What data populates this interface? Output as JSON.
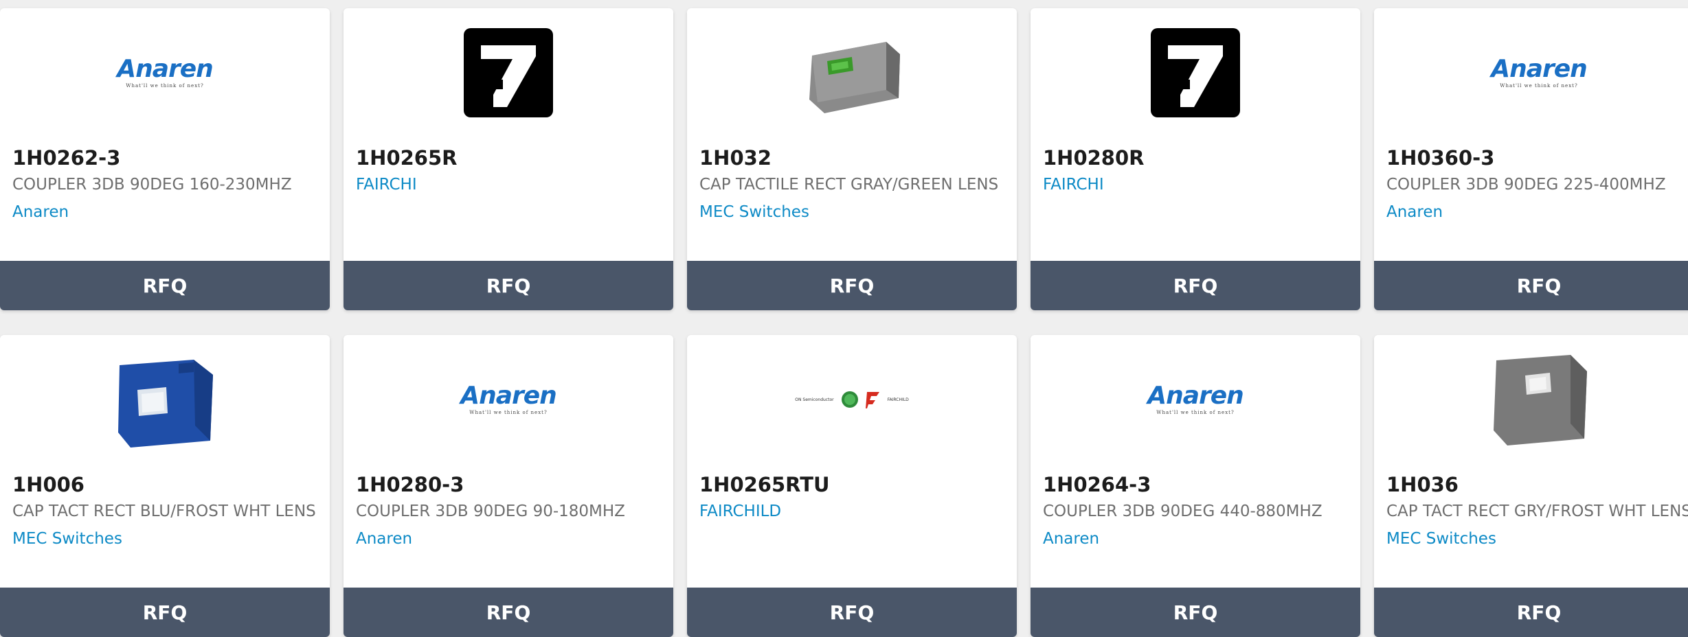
{
  "cards": [
    {
      "part": "1H0262-3",
      "description": "COUPLER 3DB 90DEG 160-230MHZ",
      "manufacturer": "Anaren",
      "logo": "anaren-logo",
      "anaren_word": "Anaren",
      "anaren_tag": "What'll we think of next?",
      "rfq": "RFQ"
    },
    {
      "part": "1H0265R",
      "description": "",
      "manufacturer": "FAIRCHI",
      "logo": "seven-logo",
      "rfq": "RFQ"
    },
    {
      "part": "1H032",
      "description": "CAP TACTILE RECT GRAY/GREEN LENS",
      "manufacturer": "MEC Switches",
      "logo": "gray-cap-green-lens-image",
      "rfq": "RFQ"
    },
    {
      "part": "1H0280R",
      "description": "",
      "manufacturer": "FAIRCHI",
      "logo": "seven-logo",
      "rfq": "RFQ"
    },
    {
      "part": "1H0360-3",
      "description": "COUPLER 3DB 90DEG 225-400MHZ",
      "manufacturer": "Anaren",
      "logo": "anaren-logo",
      "anaren_word": "Anaren",
      "anaren_tag": "What'll we think of next?",
      "rfq": "RFQ"
    },
    {
      "part": "1H006",
      "description": "CAP TACT RECT BLU/FROST WHT LENS",
      "manufacturer": "MEC Switches",
      "logo": "blue-cap-image",
      "rfq": "RFQ"
    },
    {
      "part": "1H0280-3",
      "description": "COUPLER 3DB 90DEG 90-180MHZ",
      "manufacturer": "Anaren",
      "logo": "anaren-logo",
      "anaren_word": "Anaren",
      "anaren_tag": "What'll we think of next?",
      "rfq": "RFQ"
    },
    {
      "part": "1H0265RTU",
      "description": "",
      "manufacturer": "FAIRCHILD",
      "logo": "onsemi-fairchild-logo",
      "logo_left": "ON Semiconductor",
      "logo_right": "FAIRCHILD",
      "rfq": "RFQ"
    },
    {
      "part": "1H0264-3",
      "description": "COUPLER 3DB 90DEG 440-880MHZ",
      "manufacturer": "Anaren",
      "logo": "anaren-logo",
      "anaren_word": "Anaren",
      "anaren_tag": "What'll we think of next?",
      "rfq": "RFQ"
    },
    {
      "part": "1H036",
      "description": "CAP TACT RECT GRY/FROST WHT LENS",
      "manufacturer": "MEC Switches",
      "logo": "gray-cap-image",
      "rfq": "RFQ"
    }
  ],
  "colors": {
    "rfq_bar": "#4a5669",
    "manufacturer_link": "#0d8ac6",
    "anaren_blue": "#1a6fc4",
    "cap_blue": "#1f4ea8",
    "cap_gray": "#7a7a7a",
    "lens_green": "#3a9a2a",
    "fairchild_red": "#d62b1f"
  }
}
